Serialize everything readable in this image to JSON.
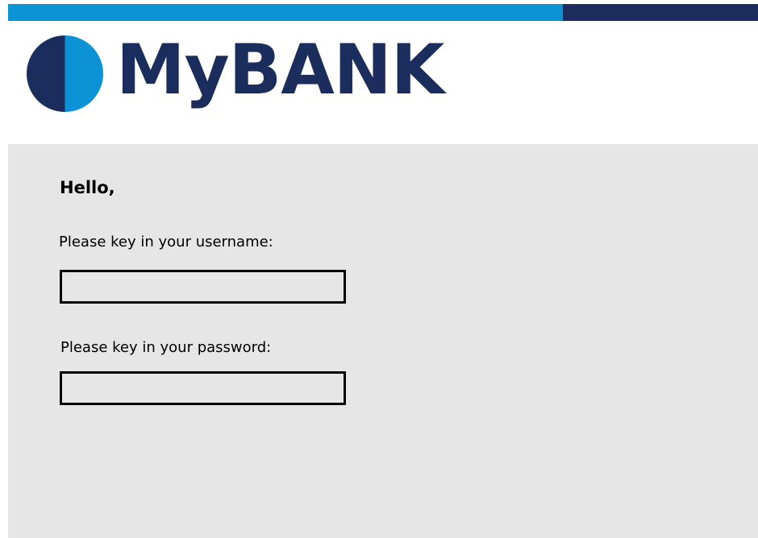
{
  "brand": {
    "name": "MyBANK",
    "logo_icon": "half-circle-logo-icon"
  },
  "login": {
    "greeting": "Hello,",
    "username_label": "Please key in your username:",
    "username_value": "",
    "password_label": "Please key in your password:",
    "password_value": ""
  },
  "colors": {
    "brand_dark": "#1b2d5c",
    "brand_light": "#0c93d5",
    "panel_bg": "#e6e6e6"
  }
}
